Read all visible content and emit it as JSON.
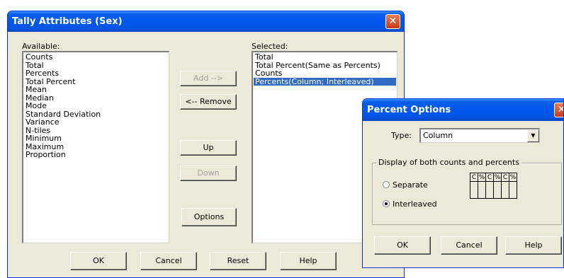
{
  "tally": {
    "title": "Tally Attributes (Sex)",
    "available_label": "Available:",
    "selected_label": "Selected:",
    "available_items": [
      "Counts",
      "Total",
      "Percents",
      "Total Percent",
      "Mean",
      "Median",
      "Mode",
      "Standard Deviation",
      "Variance",
      "N-tiles",
      "Minimum",
      "Maximum",
      "Proportion"
    ],
    "selected_items": [
      "Total",
      "Total Percent(Same as Percents)",
      "Counts",
      "Percents(Column; Interleaved)"
    ],
    "selected_highlight": "Percents(Column; Interleaved)",
    "buttons": {
      "add": "Add -->",
      "remove": "<-- Remove",
      "up": "Up",
      "down": "Down",
      "options": "Options",
      "ok": "OK",
      "cancel": "Cancel",
      "reset": "Reset",
      "help": "Help"
    },
    "close_icon": "close-icon"
  },
  "percent_options": {
    "title": "Percent Options",
    "type_label": "Type:",
    "type_value": "Column",
    "group_label": "Display of both counts and percents",
    "radio_separate": "Separate",
    "radio_interleaved": "Interleaved",
    "selected_radio": "Interleaved",
    "grid_headers": [
      "C",
      "%",
      "C",
      "%",
      "C",
      "%"
    ],
    "buttons": {
      "ok": "OK",
      "cancel": "Cancel",
      "help": "Help"
    }
  },
  "colors": {
    "titlebar": "#0055e5",
    "dialog_bg": "#ece9d8",
    "selection": "#316ac5",
    "close": "#c6391a"
  }
}
